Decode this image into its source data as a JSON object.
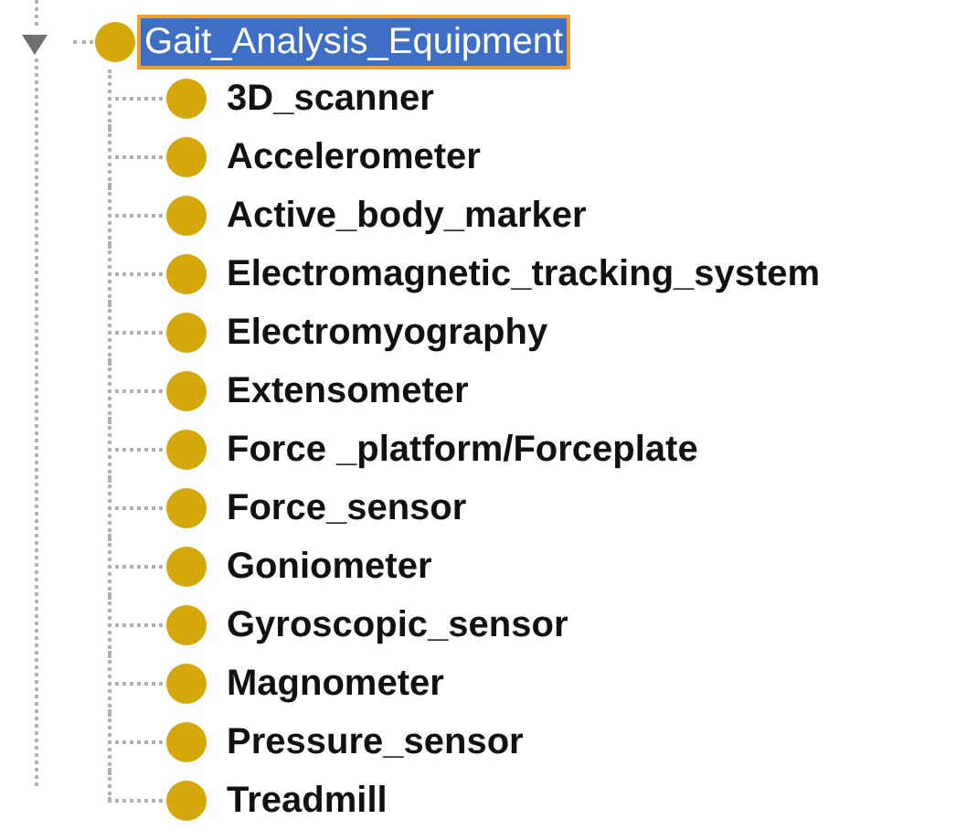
{
  "tree": {
    "label": "Gait_Analysis_Equipment",
    "expanded": true,
    "selected": true,
    "children": [
      {
        "label": "3D_scanner",
        "selected": false
      },
      {
        "label": "Accelerometer",
        "selected": false
      },
      {
        "label": "Active_body_marker",
        "selected": false
      },
      {
        "label": "Electromagnetic_tracking_system",
        "selected": false
      },
      {
        "label": "Electromyography",
        "selected": false
      },
      {
        "label": "Extensometer",
        "selected": false
      },
      {
        "label": "Force _platform/Forceplate",
        "selected": false
      },
      {
        "label": "Force_sensor",
        "selected": false
      },
      {
        "label": "Goniometer",
        "selected": false
      },
      {
        "label": "Gyroscopic_sensor",
        "selected": false
      },
      {
        "label": "Magnometer",
        "selected": false
      },
      {
        "label": "Pressure_sensor",
        "selected": false
      },
      {
        "label": "Treadmill",
        "selected": false
      }
    ]
  }
}
